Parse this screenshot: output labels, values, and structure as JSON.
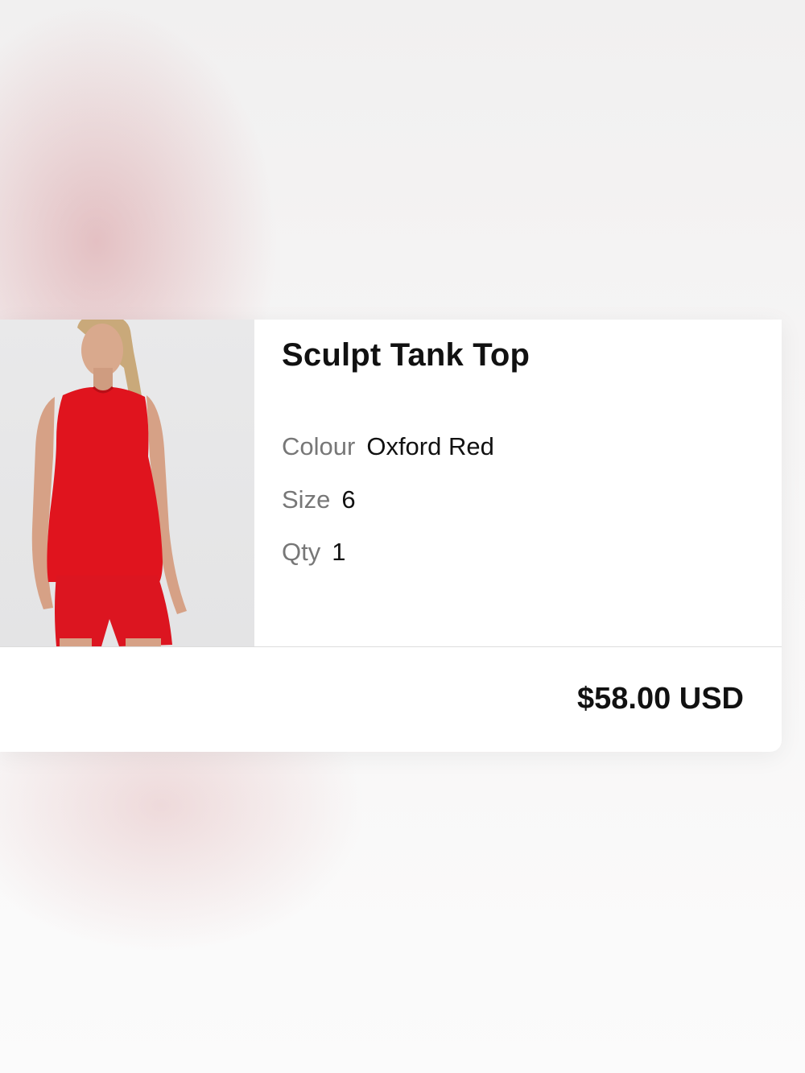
{
  "item": {
    "title": "Sculpt Tank Top",
    "image_icon": "product-photo",
    "colour_label": "Colour",
    "colour_value": "Oxford Red",
    "size_label": "Size",
    "size_value": "6",
    "qty_label": "Qty",
    "qty_value": "1",
    "price": "$58.00 USD"
  },
  "colors": {
    "product_red": "#e0141e",
    "muted_label": "#777777"
  }
}
